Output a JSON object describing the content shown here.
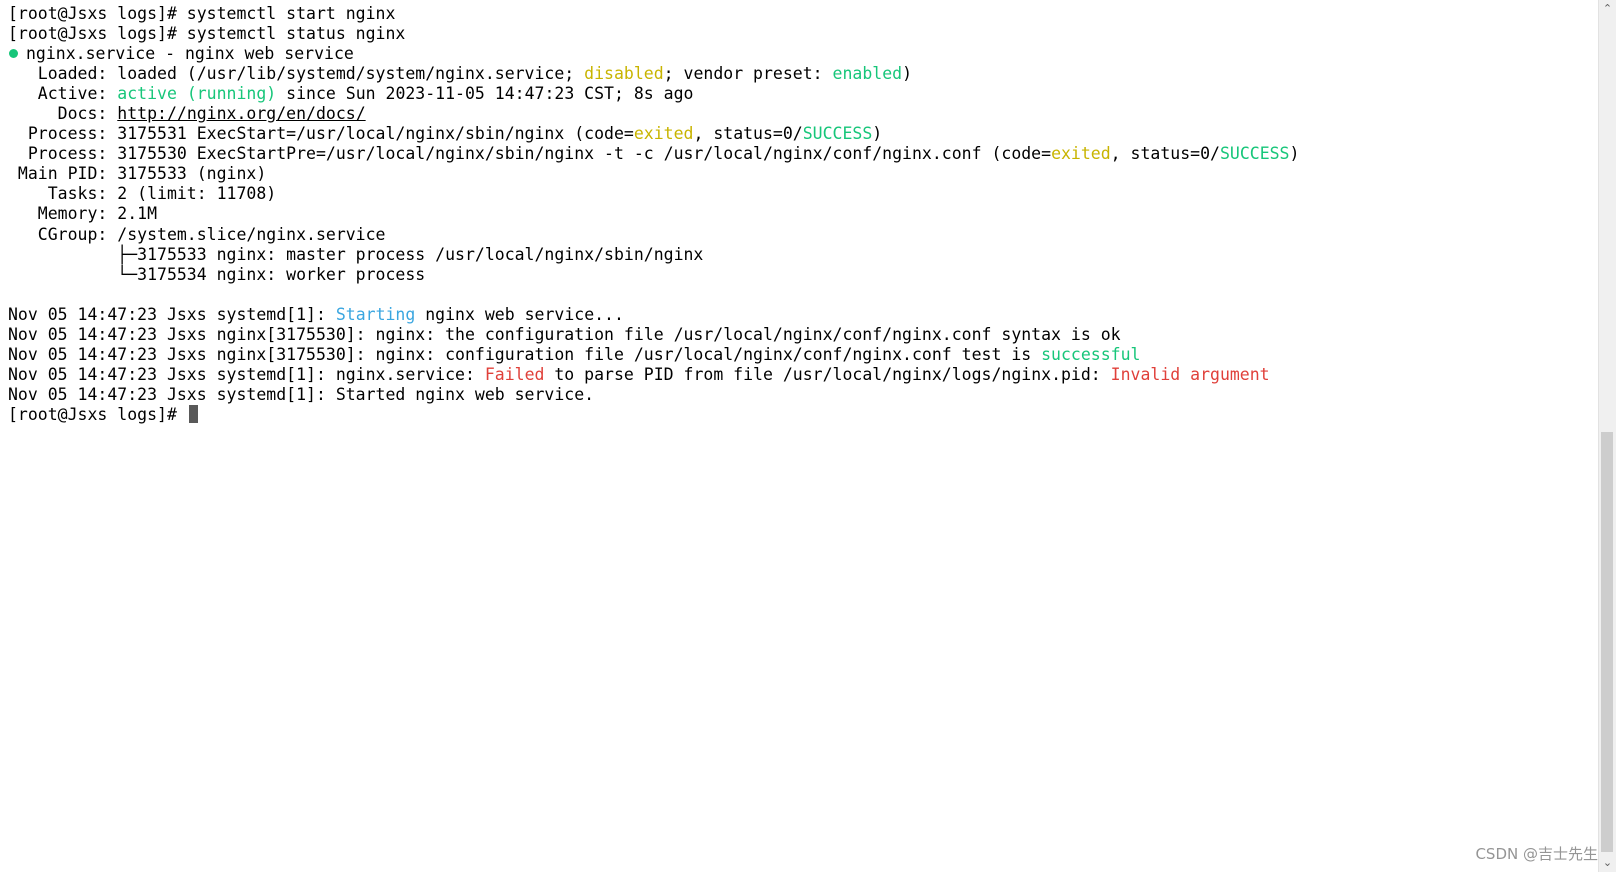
{
  "colors": {
    "background": "#ffffff",
    "text": "#000000",
    "green": "#17c67a",
    "yellow": "#c8b400",
    "cyan": "#3aa6e0",
    "red": "#e0403a"
  },
  "terminal": {
    "lines": [
      {
        "segments": [
          {
            "text": "[root@Jsxs logs]# systemctl start nginx"
          }
        ]
      },
      {
        "segments": [
          {
            "text": "[root@Jsxs logs]# systemctl status nginx"
          }
        ]
      },
      {
        "dot": true,
        "segments": [
          {
            "text": "nginx.service - nginx web service"
          }
        ]
      },
      {
        "segments": [
          {
            "text": "   Loaded: loaded (/usr/lib/systemd/system/nginx.service; "
          },
          {
            "text": "disabled",
            "color": "yellow"
          },
          {
            "text": "; vendor preset: "
          },
          {
            "text": "enabled",
            "color": "green"
          },
          {
            "text": ")"
          }
        ]
      },
      {
        "segments": [
          {
            "text": "   Active: "
          },
          {
            "text": "active (running)",
            "color": "green"
          },
          {
            "text": " since Sun 2023-11-05 14:47:23 CST; 8s ago"
          }
        ]
      },
      {
        "segments": [
          {
            "text": "     Docs: "
          },
          {
            "text": "http://nginx.org/en/docs/",
            "link": true
          }
        ]
      },
      {
        "segments": [
          {
            "text": "  Process: 3175531 ExecStart=/usr/local/nginx/sbin/nginx (code="
          },
          {
            "text": "exited",
            "color": "yellow"
          },
          {
            "text": ", status=0/"
          },
          {
            "text": "SUCCESS",
            "color": "green"
          },
          {
            "text": ")"
          }
        ]
      },
      {
        "segments": [
          {
            "text": "  Process: 3175530 ExecStartPre=/usr/local/nginx/sbin/nginx -t -c /usr/local/nginx/conf/nginx.conf (code="
          },
          {
            "text": "exited",
            "color": "yellow"
          },
          {
            "text": ", status=0/"
          },
          {
            "text": "SUCCESS",
            "color": "green"
          },
          {
            "text": ")"
          }
        ]
      },
      {
        "segments": [
          {
            "text": " Main PID: 3175533 (nginx)"
          }
        ]
      },
      {
        "segments": [
          {
            "text": "    Tasks: 2 (limit: 11708)"
          }
        ]
      },
      {
        "segments": [
          {
            "text": "   Memory: 2.1M"
          }
        ]
      },
      {
        "segments": [
          {
            "text": "   CGroup: /system.slice/nginx.service"
          }
        ]
      },
      {
        "segments": [
          {
            "text": "           ├─3175533 nginx: master process /usr/local/nginx/sbin/nginx"
          }
        ]
      },
      {
        "segments": [
          {
            "text": "           └─3175534 nginx: worker process"
          }
        ]
      },
      {
        "segments": [
          {
            "text": ""
          }
        ]
      },
      {
        "segments": [
          {
            "text": "Nov 05 14:47:23 Jsxs systemd[1]: "
          },
          {
            "text": "Starting",
            "color": "cyan"
          },
          {
            "text": " nginx web service..."
          }
        ]
      },
      {
        "segments": [
          {
            "text": "Nov 05 14:47:23 Jsxs nginx[3175530]: nginx: the configuration file /usr/local/nginx/conf/nginx.conf syntax is ok"
          }
        ]
      },
      {
        "segments": [
          {
            "text": "Nov 05 14:47:23 Jsxs nginx[3175530]: nginx: configuration file /usr/local/nginx/conf/nginx.conf test is "
          },
          {
            "text": "successful",
            "color": "green"
          }
        ]
      },
      {
        "segments": [
          {
            "text": "Nov 05 14:47:23 Jsxs systemd[1]: nginx.service: "
          },
          {
            "text": "Failed",
            "color": "red"
          },
          {
            "text": " to parse PID from file /usr/local/nginx/logs/nginx.pid: "
          },
          {
            "text": "Invalid argument",
            "color": "red"
          }
        ]
      },
      {
        "segments": [
          {
            "text": "Nov 05 14:47:23 Jsxs systemd[1]: Started nginx web service."
          }
        ]
      },
      {
        "cursor": true,
        "segments": [
          {
            "text": "[root@Jsxs logs]# "
          }
        ]
      }
    ]
  },
  "scrollbar": {
    "up_icon": "chevron-up-icon",
    "down_icon": "chevron-down-icon",
    "up_glyph": "⌃",
    "down_glyph": "⌄"
  },
  "watermark": "CSDN @吉士先生"
}
